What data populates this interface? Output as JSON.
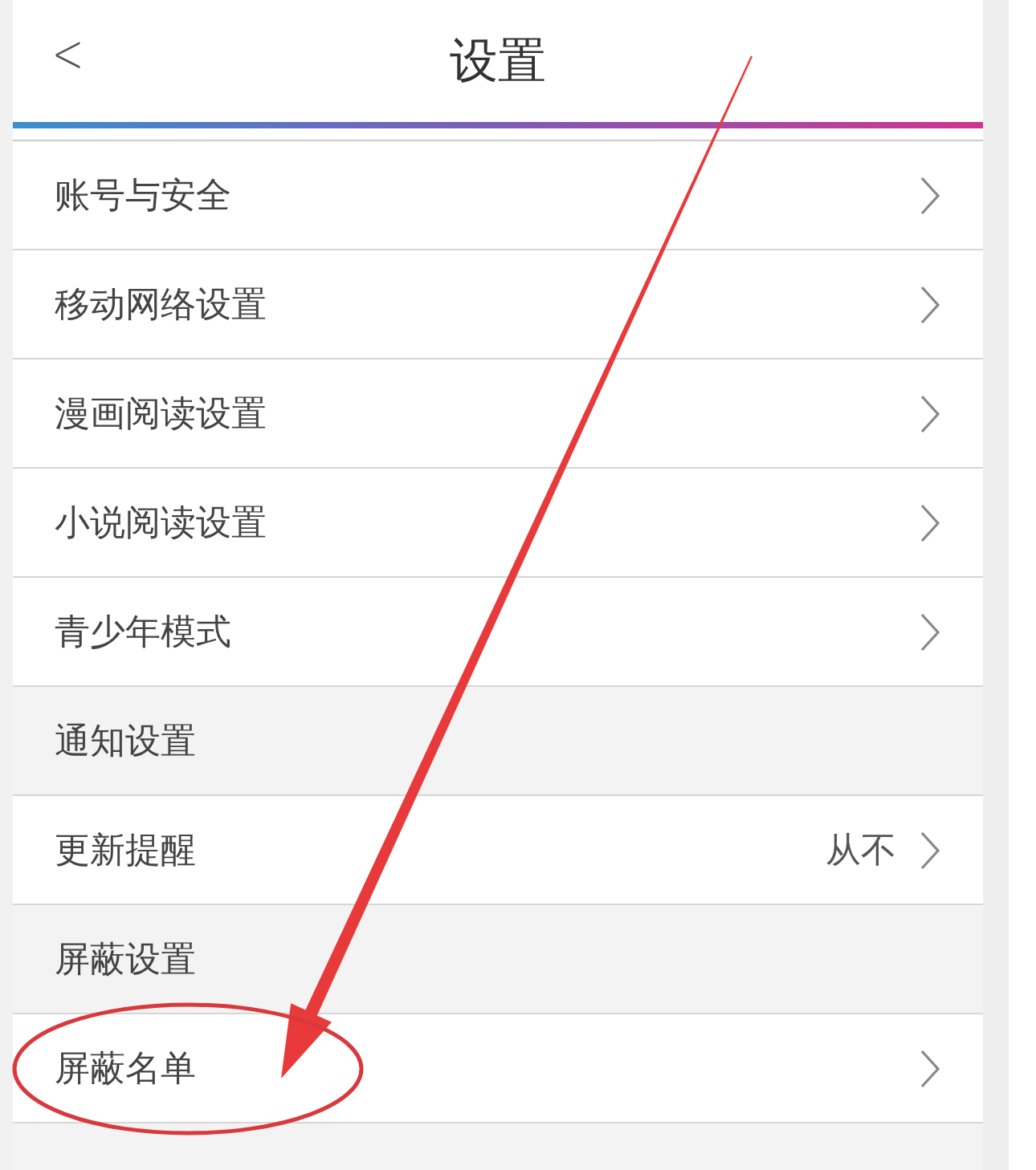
{
  "header": {
    "back": "<",
    "title": "设置"
  },
  "rows": [
    {
      "kind": "item",
      "label": "账号与安全"
    },
    {
      "kind": "item",
      "label": "移动网络设置"
    },
    {
      "kind": "item",
      "label": "漫画阅读设置"
    },
    {
      "kind": "item",
      "label": "小说阅读设置"
    },
    {
      "kind": "item",
      "label": "青少年模式"
    },
    {
      "kind": "section",
      "label": "通知设置"
    },
    {
      "kind": "item",
      "label": "更新提醒",
      "value": "从不"
    },
    {
      "kind": "section",
      "label": "屏蔽设置"
    },
    {
      "kind": "item",
      "label": "屏蔽名单"
    },
    {
      "kind": "section"
    }
  ]
}
